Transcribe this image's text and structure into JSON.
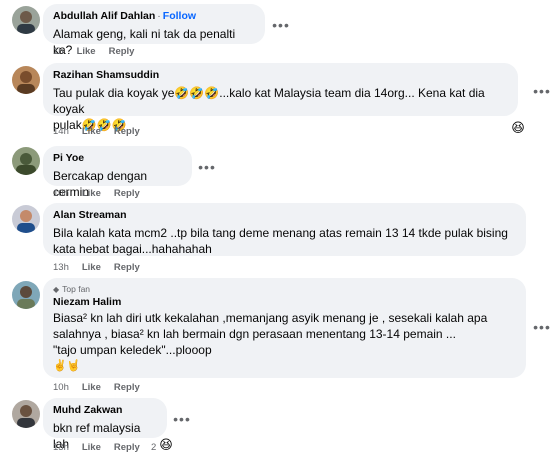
{
  "comments": [
    {
      "name": "Abdullah Alif Dahlan",
      "follow": "Follow",
      "text": "Alamak geng, kali ni tak da penalti ka?",
      "time": "1h",
      "like": "Like",
      "reply": "Reply"
    },
    {
      "name": "Razihan Shamsuddin",
      "text_lines": [
        "Tau pulak dia koyak ye🤣🤣🤣...kalo kat Malaysia team dia 14org... Kena kat dia koyak",
        "pulak🤣🤣🤣"
      ],
      "time": "14h",
      "like": "Like",
      "reply": "Reply",
      "reaction": "😆"
    },
    {
      "name": "Pi Yoe",
      "text": "Bercakap dengan cermin",
      "time": "10h",
      "like": "Like",
      "reply": "Reply"
    },
    {
      "name": "Alan Streaman",
      "text_lines": [
        "Bila kalah kata mcm2 ..tp bila tang deme menang atas remain 13 14 tkde pulak bising",
        "kata hebat bagai...hahahahah"
      ],
      "time": "13h",
      "like": "Like",
      "reply": "Reply"
    },
    {
      "badge": "Top fan",
      "name": "Niezam Halim",
      "text_lines": [
        "Biasa² kn lah diri utk kekalahan ,memanjang asyik menang je , sesekali kalah apa",
        "salahnya , biasa² kn lah bermain dgn perasaan menentang 13-14 pemain ...",
        "\"tajo umpan keledek\"...plooop",
        "✌️🤘"
      ],
      "time": "10h",
      "like": "Like",
      "reply": "Reply"
    },
    {
      "name": "Muhd Zakwan",
      "text": "bkn ref malaysia lah",
      "time": "13h",
      "like": "Like",
      "reply": "Reply",
      "reaction_count": "2",
      "reaction": "😆"
    }
  ],
  "more_icon": "•••"
}
